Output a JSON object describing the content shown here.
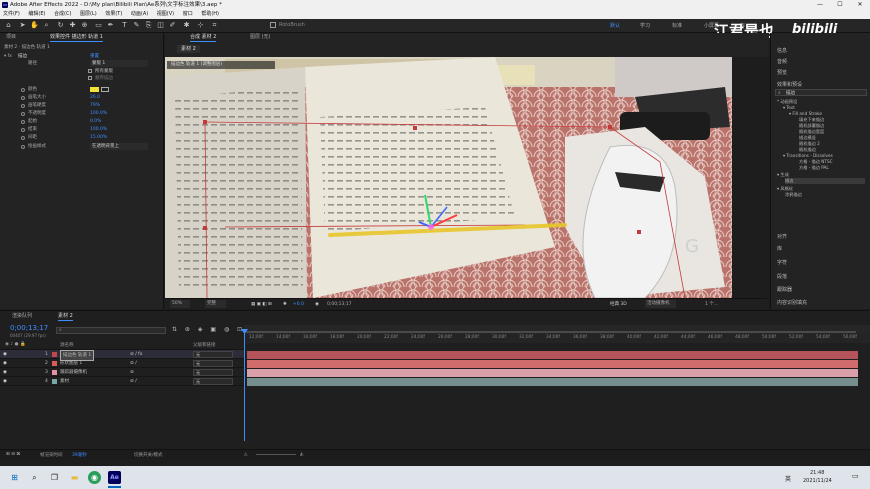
{
  "window": {
    "title": "Adobe After Effects 2022 - D:\\My plan\\Bilibili Plan\\Ae系列\\文字标注效果\\3.aep *",
    "logo_text": "Ae",
    "minimize": "—",
    "maximize": "☐",
    "close": "✕"
  },
  "menu": [
    "文件(F)",
    "编辑(E)",
    "合成(C)",
    "图层(L)",
    "效果(T)",
    "动画(A)",
    "视图(V)",
    "窗口",
    "帮助(H)"
  ],
  "toolbar": {
    "snap_label": "RotoBrush",
    "workspaces": [
      "默认",
      "学习",
      "标准",
      "小屏幕",
      "库"
    ],
    "search_icon": "search-icon"
  },
  "watermark": {
    "text": "江君是也",
    "brand": "bilibili"
  },
  "left_panel": {
    "tabs": [
      "项目",
      "效果控件 描边形 轨道 1"
    ],
    "breadcrumb": "素材 2 · 描边色 轨道 1",
    "effect_name": "描边",
    "rows": [
      {
        "label": "路径",
        "value": "蒙版 1"
      },
      {
        "label": "",
        "value": "所有蒙版"
      },
      {
        "label": "",
        "value": "顺序描边"
      },
      {
        "label": "颜色",
        "value": ""
      },
      {
        "label": "画笔大小",
        "value": "26.0"
      },
      {
        "label": "画笔硬度",
        "value": "79%"
      },
      {
        "label": "不透明度",
        "value": "100.0%"
      },
      {
        "label": "起始",
        "value": "0.0%"
      },
      {
        "label": "结束",
        "value": "100.0%"
      },
      {
        "label": "间距",
        "value": "15.00%"
      },
      {
        "label": "绘画样式",
        "value": "在透明背景上"
      }
    ],
    "reset_label": "重置"
  },
  "comp_panel": {
    "tabs": [
      "合成 素材 2",
      "图层 (无)"
    ],
    "inner_tab": "素材 2",
    "overlay_text": "描边色 轨道 1 (调整图层)"
  },
  "viewer_bar": {
    "zoom": "50%",
    "quality": "完整",
    "timecode": "0;00;13;17",
    "exposure": "+0.0",
    "renderer": "经典 3D",
    "camera": "活动摄像机",
    "views": "1 个..."
  },
  "right_panel": {
    "top_items": [
      "信息",
      "音频",
      "预览"
    ],
    "effects_title": "效果和预设",
    "search_value": "描边",
    "tree": [
      {
        "label": "* 动画预设",
        "indent": 0
      },
      {
        "label": "▾ Text",
        "indent": 1
      },
      {
        "label": "▾ Fill and Stroke",
        "indent": 2
      },
      {
        "label": "填充下来描边",
        "indent": 3
      },
      {
        "label": "随机部署描边",
        "indent": 3
      },
      {
        "label": "随机描边宽度",
        "indent": 3
      },
      {
        "label": "描边横竖",
        "indent": 3
      },
      {
        "label": "随机描边 2",
        "indent": 3
      },
      {
        "label": "随机描边",
        "indent": 3
      },
      {
        "label": "▾ Transitions - Dissolves",
        "indent": 1
      },
      {
        "label": "方格 - 描边 NTSC",
        "indent": 3
      },
      {
        "label": "方格 - 描边 PAL",
        "indent": 3
      },
      {
        "label": "▾ 生成",
        "indent": 0
      },
      {
        "label": "描边",
        "indent": 2
      },
      {
        "label": "▾ 风格化",
        "indent": 0
      },
      {
        "label": "涂鸦描边",
        "indent": 2
      }
    ],
    "bottom_items": [
      "对齐",
      "库",
      "字符",
      "段落",
      "跟踪器",
      "内容识别填充"
    ]
  },
  "timeline": {
    "tabs": [
      "渲染队列",
      "素材 2"
    ],
    "timecode": "0;00;13;17",
    "frame_info": "00407 (29.97 fps)",
    "columns": [
      "源名称",
      "父级和链接"
    ],
    "ticks": [
      "12;00f",
      "14;00f",
      "16;00f",
      "18;00f",
      "20;00f",
      "22;00f",
      "24;00f",
      "26;00f",
      "28;00f",
      "30;00f",
      "32;00f",
      "34;00f",
      "36;00f",
      "38;00f",
      "40;00f",
      "42;00f",
      "44;00f",
      "46;00f",
      "48;00f",
      "50;00f",
      "52;00f",
      "54;00f",
      "56;00f"
    ],
    "layers": [
      {
        "num": "1",
        "name": "描边色 轨道 1",
        "parent": "无",
        "color": "#c0474b"
      },
      {
        "num": "2",
        "name": "形状图层 1",
        "parent": "无",
        "color": "#d95a5a"
      },
      {
        "num": "3",
        "name": "跟踪器摄像机",
        "parent": "无",
        "color": "#e48fa2"
      },
      {
        "num": "4",
        "name": "素材",
        "parent": "无",
        "color": "#79a6a6"
      }
    ],
    "bar_colors": [
      "#b4545a",
      "#d06c6c",
      "#d9a0aa",
      "#778e8e"
    ],
    "footer": {
      "render_time_label": "帧渲染时间",
      "render_time": "39毫秒",
      "toggle": "切换开关/模式"
    }
  },
  "taskbar": {
    "apps": [
      "windows-icon",
      "search-icon",
      "taskview-icon",
      "explorer-icon",
      "edge-icon",
      "chrome-icon",
      "folder-icon",
      "aftereffects-icon"
    ],
    "ime": "英",
    "time": "21:48",
    "date": "2021/11/24"
  }
}
